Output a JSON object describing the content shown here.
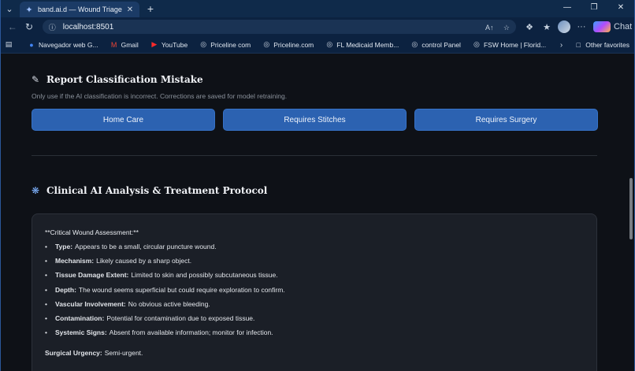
{
  "browser": {
    "tab_title": "band.ai.d — Wound Triage",
    "url": "localhost:8501",
    "chat_label": "Chat",
    "favorites": [
      {
        "icon": "google-icon",
        "label": "Navegador web G..."
      },
      {
        "icon": "gmail-icon",
        "label": "Gmail"
      },
      {
        "icon": "youtube-icon",
        "label": "YouTube"
      },
      {
        "icon": "globe-icon",
        "label": "Priceline com"
      },
      {
        "icon": "globe-icon",
        "label": "Priceline.com"
      },
      {
        "icon": "globe-icon",
        "label": "FL Medicaid Memb..."
      },
      {
        "icon": "globe-icon",
        "label": "control Panel"
      },
      {
        "icon": "globe-icon",
        "label": "FSW Home | Florid..."
      }
    ],
    "other_favorites": "Other favorites"
  },
  "report": {
    "title": "Report Classification Mistake",
    "subtitle": "Only use if the AI classification is incorrect. Corrections are saved for model retraining.",
    "buttons": [
      "Home Care",
      "Requires Stitches",
      "Requires Surgery"
    ]
  },
  "analysis": {
    "title": "Clinical AI Analysis & Treatment Protocol",
    "heading": "**Critical Wound Assessment:**",
    "items": [
      {
        "label": "Type:",
        "text": "Appears to be a small, circular puncture wound."
      },
      {
        "label": "Mechanism:",
        "text": "Likely caused by a sharp object."
      },
      {
        "label": "Tissue Damage Extent:",
        "text": "Limited to skin and possibly subcutaneous tissue."
      },
      {
        "label": "Depth:",
        "text": "The wound seems superficial but could require exploration to confirm."
      },
      {
        "label": "Vascular Involvement:",
        "text": "No obvious active bleeding."
      },
      {
        "label": "Contamination:",
        "text": "Potential for contamination due to exposed tissue."
      },
      {
        "label": "Systemic Signs:",
        "text": "Absent from available information; monitor for infection."
      }
    ],
    "urgency_label": "Surgical Urgency:",
    "urgency_value": "Semi-urgent."
  }
}
